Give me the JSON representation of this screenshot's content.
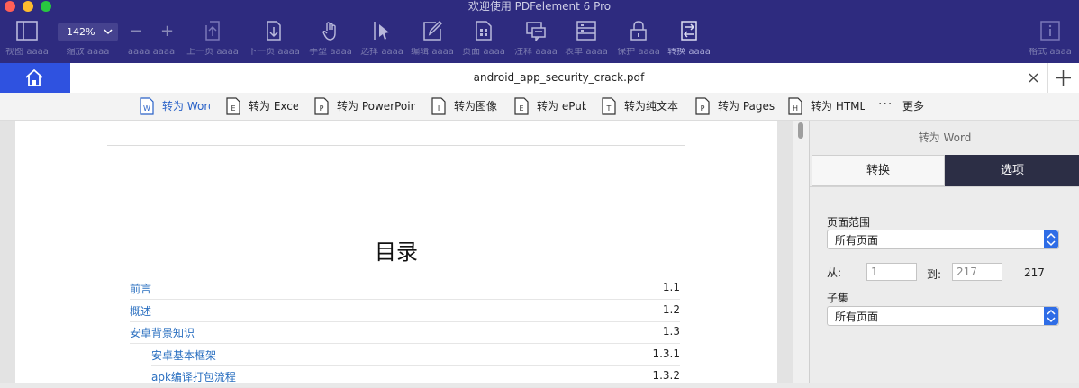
{
  "window": {
    "title": "欢迎使用 PDFelement 6 Pro"
  },
  "colors": {
    "titlebar": "#2e2b7f",
    "accent": "#2f52e0",
    "panel_tab_active": "#2c2e45"
  },
  "toolbar": {
    "zoom_value": "142%",
    "buttons": [
      {
        "icon": "view-icon",
        "label": "视图 aaaa"
      },
      {
        "icon": "zoom-icon",
        "label": "缩放 aaaa"
      },
      {
        "icon": "zoom-out-in-icon",
        "label": "aaaa  aaaa"
      },
      {
        "icon": "prev-page-icon",
        "label": "上一页 aaaa"
      },
      {
        "icon": "next-page-icon",
        "label": "下一页 aaaa"
      },
      {
        "icon": "hand-icon",
        "label": "手型 aaaa"
      },
      {
        "icon": "select-icon",
        "label": "选择 aaaa"
      },
      {
        "icon": "edit-icon",
        "label": "编辑 aaaa"
      },
      {
        "icon": "page-icon",
        "label": "页面 aaaa"
      },
      {
        "icon": "comment-icon",
        "label": "注释 aaaa"
      },
      {
        "icon": "form-icon",
        "label": "表单 aaaa"
      },
      {
        "icon": "protect-icon",
        "label": "保护 aaaa"
      },
      {
        "icon": "convert-icon",
        "label": "转换 aaaa"
      },
      {
        "icon": "format-icon",
        "label": "格式 aaaa"
      }
    ]
  },
  "tab": {
    "filename": "android_app_security_crack.pdf"
  },
  "convert_bar": {
    "items": [
      {
        "icon": "W",
        "label": "转为 Word",
        "active": true
      },
      {
        "icon": "E",
        "label": "转为 Excel"
      },
      {
        "icon": "P",
        "label": "转为 PowerPoint"
      },
      {
        "icon": "I",
        "label": "转为图像"
      },
      {
        "icon": "E",
        "label": "转为 ePub"
      },
      {
        "icon": "T",
        "label": "转为纯文本"
      },
      {
        "icon": "P",
        "label": "转为 Pages"
      },
      {
        "icon": "H",
        "label": "转为 HTML"
      }
    ],
    "more_label": "更多"
  },
  "document": {
    "toc_title": "目录",
    "toc": [
      {
        "label": "前言",
        "num": "1.1",
        "level": 0
      },
      {
        "label": "概述",
        "num": "1.2",
        "level": 0
      },
      {
        "label": "安卓背景知识",
        "num": "1.3",
        "level": 0
      },
      {
        "label": "安卓基本框架",
        "num": "1.3.1",
        "level": 1
      },
      {
        "label": "apk编译打包流程",
        "num": "1.3.2",
        "level": 1
      }
    ]
  },
  "panel": {
    "title": "转为 Word",
    "tabs": [
      "转换",
      "选项"
    ],
    "page_range_label": "页面范围",
    "page_range_value": "所有页面",
    "from_label": "从:",
    "from_value": "1",
    "to_label": "到:",
    "to_value": "217",
    "total_pages": "217",
    "subset_label": "子集",
    "subset_value": "所有页面"
  }
}
